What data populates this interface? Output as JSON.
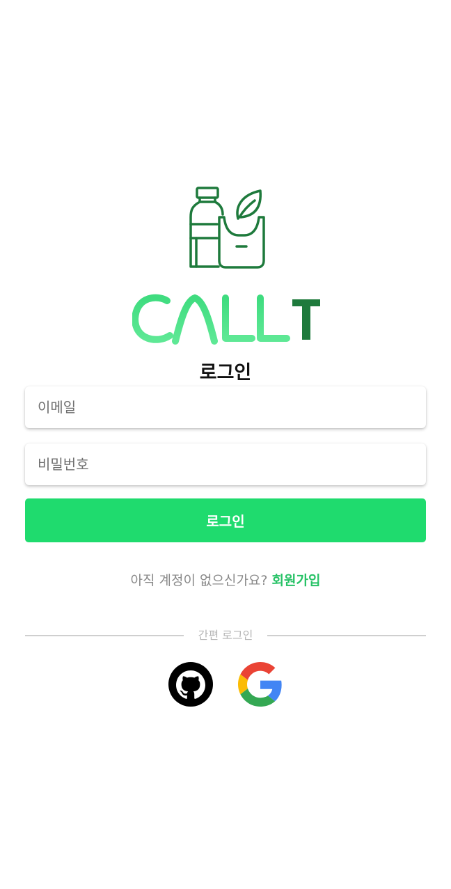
{
  "brand": {
    "logo_icon": "bottle-and-bag-leaf-icon",
    "name": "CALLT",
    "colors": {
      "light_green": "#3fdc7f",
      "dark_green": "#1e7a3c",
      "accent": "#1fdb6e"
    }
  },
  "login": {
    "title": "로그인",
    "email_placeholder": "이메일",
    "password_placeholder": "비밀번호",
    "submit_label": "로그인"
  },
  "signup": {
    "prompt": "아직 계정이 없으신가요?",
    "link_label": "회원가입"
  },
  "social": {
    "divider_label": "간편 로그인",
    "providers": [
      {
        "name": "github",
        "icon": "github-icon"
      },
      {
        "name": "google",
        "icon": "google-icon"
      }
    ]
  }
}
